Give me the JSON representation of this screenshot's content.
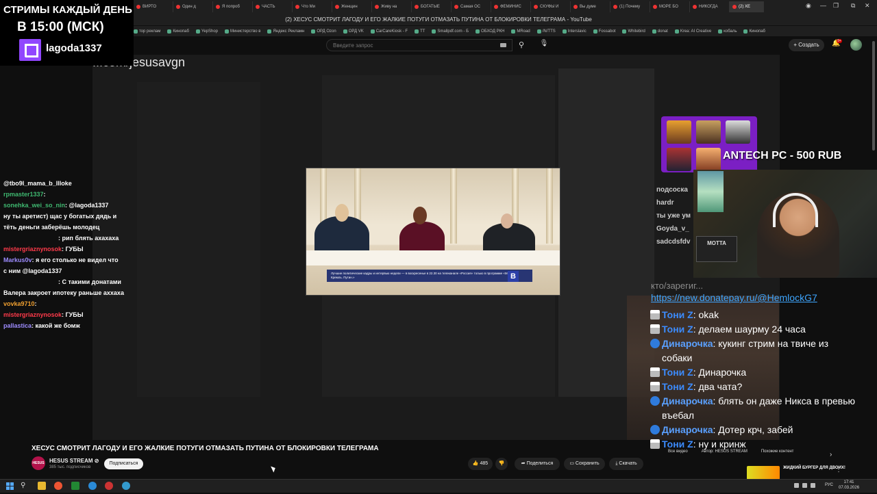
{
  "browser": {
    "tabs": [
      "ВИРТО",
      "Один д",
      "Я попроб",
      "ЧАСТЬ",
      "Что Ми",
      "Женщин",
      "Живу на",
      "БОГАТЫЕ",
      "Самая ОС",
      "ФЕМИНИС",
      "СКУФЫ И",
      "Вы думе",
      "(1) Почему",
      "МОРЕ БО",
      "НИКОГДА"
    ],
    "active_tab": "(2) ХЕ",
    "window_title": "(2) ХЕСУС СМОТРИТ ЛАГОДУ И ЕГО ЖАЛКИЕ ПОТУГИ ОТМАЗАТЬ ПУТИНА ОТ БЛОКИРОВКИ ТЕЛЕГРАМА - YouTube",
    "bookmarks": [
      "тор реклам",
      "Кинопаб",
      "YepShop",
      "Министерство в",
      "Яндекс Рекламн",
      "ОРД Ozon",
      "ОРД VK",
      "CarCareKiosk - F",
      "TT",
      "Smallpdf.com - Б",
      "ОБХОД РКН",
      "MRoad",
      "/N/TTS",
      "Interslavic",
      "Fossabot",
      "Whitebird",
      "donat",
      "Krea: AI Creative",
      "кобаль",
      "Кинопаб"
    ]
  },
  "youtube": {
    "search_placeholder": "Введите запрос",
    "create_label": "Создать",
    "notif_count": "9+"
  },
  "stream_banner": {
    "line1": "СТРИМЫ КАЖДЫЙ ДЕНЬ",
    "line2": "В 15:00 (МСК)",
    "twitch_user": "lagoda1337"
  },
  "video": {
    "url_overlay": "...com/jesusavgn",
    "inner_caption": "Лучшие политические кадры и интервью недели — в воскресенье в 22.30 на телеканале «Россия» только в программе «Москва. Кремль. Путин.»",
    "inner_logo": "В"
  },
  "left_chat": [
    {
      "name": "@tbo9l_mama_b_llloke",
      "text": "",
      "color": "white"
    },
    {
      "name": "rpmaster1337",
      "text": ":",
      "color": "green"
    },
    {
      "name": "sonehka_wei_so_nin",
      "text": ": @lagoda1337",
      "color": "green"
    },
    {
      "name": "",
      "text": "ну ты аретист) щас у богатых дядь и",
      "color": "white"
    },
    {
      "name": "",
      "text": "тёть деньги заберёшь молодец",
      "color": "white"
    },
    {
      "name": "",
      "text": ": рип блять ахахаха",
      "color": "red"
    },
    {
      "name": "mistergriaznynosok",
      "text": ": ГУБЫ",
      "color": "red"
    },
    {
      "name": "Markus0v",
      "text": ": я его столько не видел что",
      "color": "purple"
    },
    {
      "name": "",
      "text": "с ним @lagoda1337",
      "color": "white"
    },
    {
      "name": "",
      "text": ": С такими донатами",
      "color": "blue"
    },
    {
      "name": "",
      "text": "Валера закроет ипотеку раньше аххаха",
      "color": "white"
    },
    {
      "name": "vovka9710",
      "text": ":",
      "color": "orange"
    },
    {
      "name": "mistergriaznynosok",
      "text": ": ГУБЫ",
      "color": "red"
    },
    {
      "name": "pallastica",
      "text": ": какой же бомж",
      "color": "purple"
    }
  ],
  "sponsor": {
    "text": "ANTECH PC - 500 RUB"
  },
  "mini_chat": [
    "подсоска",
    "hardr",
    "ты уже ум",
    "Goyda_v_",
    "sadcdsfdv"
  ],
  "mic_label": "MOTTA",
  "right_chat": {
    "prev_line": "кто/зарегиг...",
    "donation_link": "https://new.donatepay.ru/@HemlockG7",
    "messages": [
      {
        "badge": "gift",
        "name": "Тони Z",
        "text": ": okak"
      },
      {
        "badge": "gift",
        "name": "Тони Z",
        "text": ": делаем шаурму 24 часа"
      },
      {
        "badge": "drop",
        "name": "Динарочка",
        "text": ": кукинг стрим на твиче из собаки"
      },
      {
        "badge": "gift",
        "name": "Тони Z",
        "text": ": Динарочка"
      },
      {
        "badge": "gift",
        "name": "Тони Z",
        "text": ": два чата?"
      },
      {
        "badge": "drop",
        "name": "Динарочка",
        "text": ": блять он даже Никса в превью въебал"
      },
      {
        "badge": "drop",
        "name": "Динарочка",
        "text": ": Дотер крч, забей"
      },
      {
        "badge": "gift",
        "name": "Тони Z",
        "text": ": ну и кринж"
      }
    ]
  },
  "video_info": {
    "title": "ХЕСУС СМОТРИТ ЛАГОДУ И ЕГО ЖАЛКИЕ ПОТУГИ ОТМАЗАТЬ ПУТИНА ОТ БЛОКИРОВКИ ТЕЛЕГРАМА",
    "channel_name": "HESUS STREAM ⊘",
    "channel_avatar_text": "HESUS",
    "subs": "385 тыс. подписчиков",
    "subscribe_label": "Подписаться",
    "likes": "485",
    "share_label": "Поделиться",
    "save_label": "Сохранить",
    "download_label": "Скачать"
  },
  "recs": {
    "chips": [
      "Все видео",
      "Автор: HESUS STREAM",
      "Похожие контент"
    ],
    "title": "ЖИДКИЙ БУРГЕР ДЛЯ ДВОИХ!"
  },
  "taskbar": {
    "lang": "РУС",
    "time": "17:41",
    "date": "07.03.2026"
  }
}
